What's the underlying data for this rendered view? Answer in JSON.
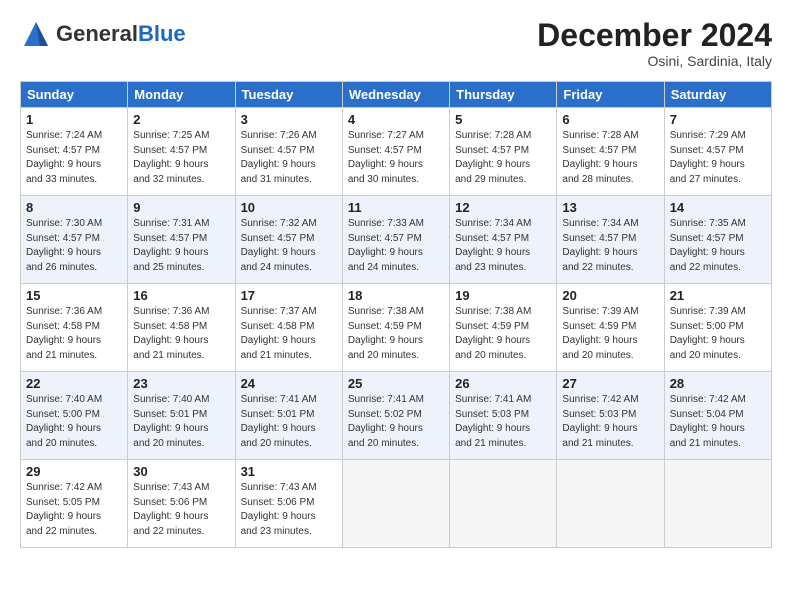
{
  "header": {
    "logo_general": "General",
    "logo_blue": "Blue",
    "month_year": "December 2024",
    "location": "Osini, Sardinia, Italy"
  },
  "weekdays": [
    "Sunday",
    "Monday",
    "Tuesday",
    "Wednesday",
    "Thursday",
    "Friday",
    "Saturday"
  ],
  "weeks": [
    [
      {
        "day": 1,
        "info": "Sunrise: 7:24 AM\nSunset: 4:57 PM\nDaylight: 9 hours\nand 33 minutes."
      },
      {
        "day": 2,
        "info": "Sunrise: 7:25 AM\nSunset: 4:57 PM\nDaylight: 9 hours\nand 32 minutes."
      },
      {
        "day": 3,
        "info": "Sunrise: 7:26 AM\nSunset: 4:57 PM\nDaylight: 9 hours\nand 31 minutes."
      },
      {
        "day": 4,
        "info": "Sunrise: 7:27 AM\nSunset: 4:57 PM\nDaylight: 9 hours\nand 30 minutes."
      },
      {
        "day": 5,
        "info": "Sunrise: 7:28 AM\nSunset: 4:57 PM\nDaylight: 9 hours\nand 29 minutes."
      },
      {
        "day": 6,
        "info": "Sunrise: 7:28 AM\nSunset: 4:57 PM\nDaylight: 9 hours\nand 28 minutes."
      },
      {
        "day": 7,
        "info": "Sunrise: 7:29 AM\nSunset: 4:57 PM\nDaylight: 9 hours\nand 27 minutes."
      }
    ],
    [
      {
        "day": 8,
        "info": "Sunrise: 7:30 AM\nSunset: 4:57 PM\nDaylight: 9 hours\nand 26 minutes."
      },
      {
        "day": 9,
        "info": "Sunrise: 7:31 AM\nSunset: 4:57 PM\nDaylight: 9 hours\nand 25 minutes."
      },
      {
        "day": 10,
        "info": "Sunrise: 7:32 AM\nSunset: 4:57 PM\nDaylight: 9 hours\nand 24 minutes."
      },
      {
        "day": 11,
        "info": "Sunrise: 7:33 AM\nSunset: 4:57 PM\nDaylight: 9 hours\nand 24 minutes."
      },
      {
        "day": 12,
        "info": "Sunrise: 7:34 AM\nSunset: 4:57 PM\nDaylight: 9 hours\nand 23 minutes."
      },
      {
        "day": 13,
        "info": "Sunrise: 7:34 AM\nSunset: 4:57 PM\nDaylight: 9 hours\nand 22 minutes."
      },
      {
        "day": 14,
        "info": "Sunrise: 7:35 AM\nSunset: 4:57 PM\nDaylight: 9 hours\nand 22 minutes."
      }
    ],
    [
      {
        "day": 15,
        "info": "Sunrise: 7:36 AM\nSunset: 4:58 PM\nDaylight: 9 hours\nand 21 minutes."
      },
      {
        "day": 16,
        "info": "Sunrise: 7:36 AM\nSunset: 4:58 PM\nDaylight: 9 hours\nand 21 minutes."
      },
      {
        "day": 17,
        "info": "Sunrise: 7:37 AM\nSunset: 4:58 PM\nDaylight: 9 hours\nand 21 minutes."
      },
      {
        "day": 18,
        "info": "Sunrise: 7:38 AM\nSunset: 4:59 PM\nDaylight: 9 hours\nand 20 minutes."
      },
      {
        "day": 19,
        "info": "Sunrise: 7:38 AM\nSunset: 4:59 PM\nDaylight: 9 hours\nand 20 minutes."
      },
      {
        "day": 20,
        "info": "Sunrise: 7:39 AM\nSunset: 4:59 PM\nDaylight: 9 hours\nand 20 minutes."
      },
      {
        "day": 21,
        "info": "Sunrise: 7:39 AM\nSunset: 5:00 PM\nDaylight: 9 hours\nand 20 minutes."
      }
    ],
    [
      {
        "day": 22,
        "info": "Sunrise: 7:40 AM\nSunset: 5:00 PM\nDaylight: 9 hours\nand 20 minutes."
      },
      {
        "day": 23,
        "info": "Sunrise: 7:40 AM\nSunset: 5:01 PM\nDaylight: 9 hours\nand 20 minutes."
      },
      {
        "day": 24,
        "info": "Sunrise: 7:41 AM\nSunset: 5:01 PM\nDaylight: 9 hours\nand 20 minutes."
      },
      {
        "day": 25,
        "info": "Sunrise: 7:41 AM\nSunset: 5:02 PM\nDaylight: 9 hours\nand 20 minutes."
      },
      {
        "day": 26,
        "info": "Sunrise: 7:41 AM\nSunset: 5:03 PM\nDaylight: 9 hours\nand 21 minutes."
      },
      {
        "day": 27,
        "info": "Sunrise: 7:42 AM\nSunset: 5:03 PM\nDaylight: 9 hours\nand 21 minutes."
      },
      {
        "day": 28,
        "info": "Sunrise: 7:42 AM\nSunset: 5:04 PM\nDaylight: 9 hours\nand 21 minutes."
      }
    ],
    [
      {
        "day": 29,
        "info": "Sunrise: 7:42 AM\nSunset: 5:05 PM\nDaylight: 9 hours\nand 22 minutes."
      },
      {
        "day": 30,
        "info": "Sunrise: 7:43 AM\nSunset: 5:06 PM\nDaylight: 9 hours\nand 22 minutes."
      },
      {
        "day": 31,
        "info": "Sunrise: 7:43 AM\nSunset: 5:06 PM\nDaylight: 9 hours\nand 23 minutes."
      },
      null,
      null,
      null,
      null
    ]
  ]
}
